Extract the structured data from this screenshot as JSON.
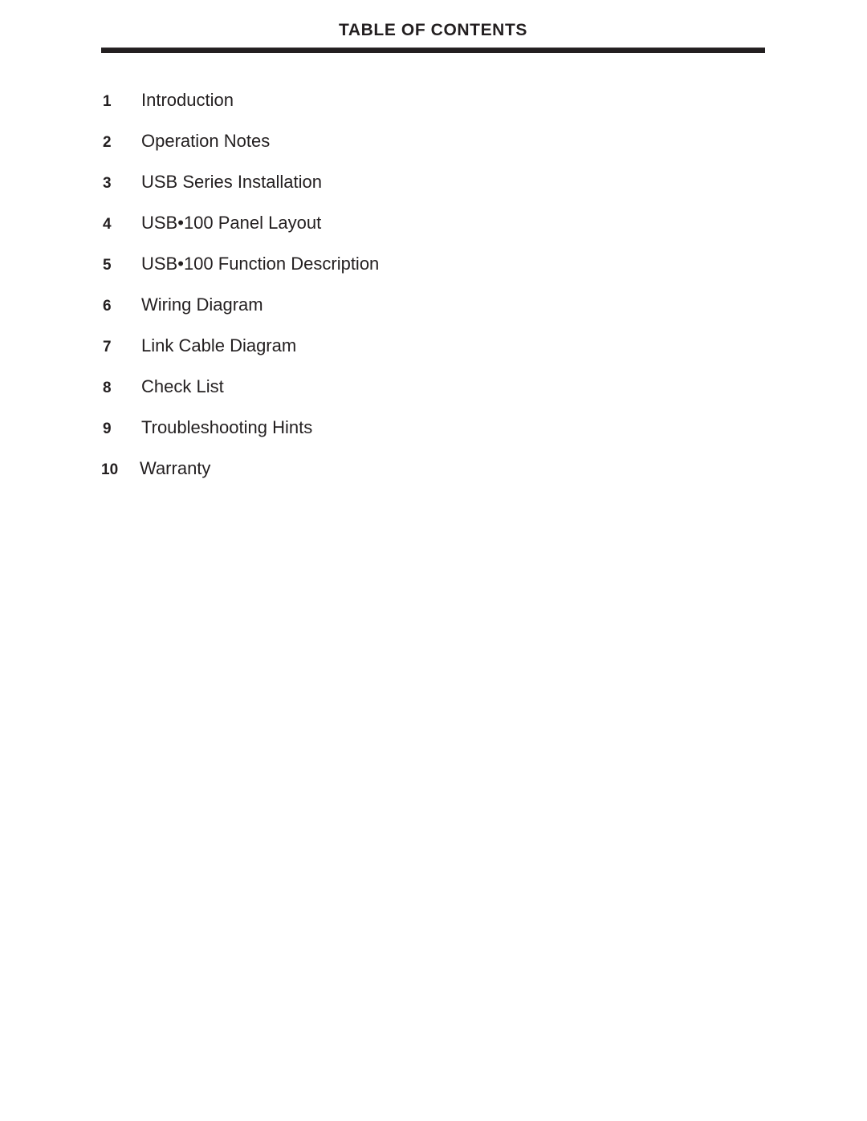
{
  "document": {
    "title": "TABLE OF CONTENTS",
    "background_color": "#ffffff",
    "text_color": "#231f20",
    "rule_color": "#231f20"
  },
  "contents": {
    "entries": [
      {
        "number": "1",
        "label": "Introduction"
      },
      {
        "number": "2",
        "label": "Operation Notes"
      },
      {
        "number": "3",
        "label": "USB Series Installation"
      },
      {
        "number": "4",
        "label": "USB•100 Panel Layout"
      },
      {
        "number": "5",
        "label": "USB•100 Function Description"
      },
      {
        "number": "6",
        "label": "Wiring Diagram"
      },
      {
        "number": "7",
        "label": "Link Cable Diagram"
      },
      {
        "number": "8",
        "label": "Check List"
      },
      {
        "number": "9",
        "label": "Troubleshooting Hints"
      },
      {
        "number": "10",
        "label": "Warranty"
      }
    ]
  }
}
